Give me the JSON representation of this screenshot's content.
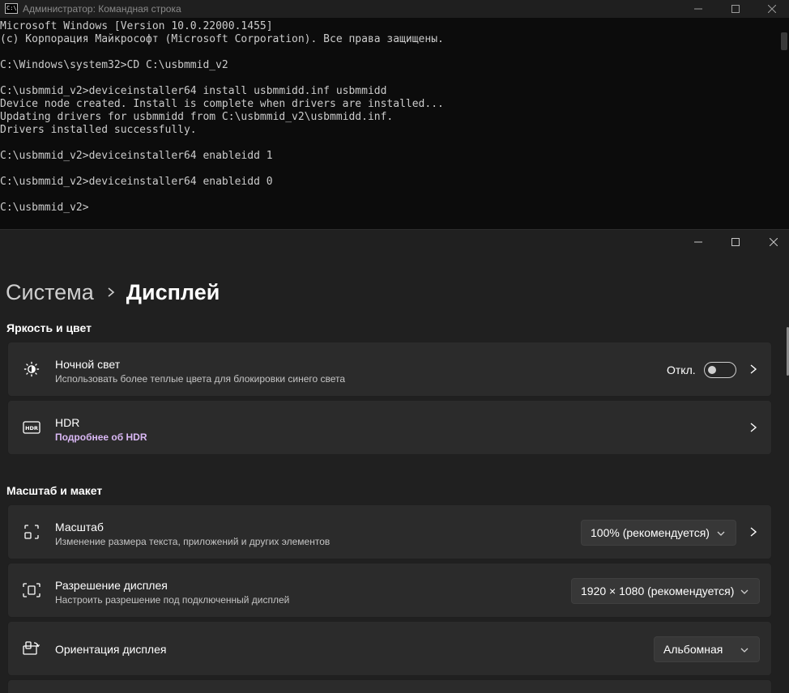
{
  "cmd": {
    "title": "Администратор: Командная строка",
    "lines": [
      "Microsoft Windows [Version 10.0.22000.1455]",
      "(c) Корпорация Майкрософт (Microsoft Corporation). Все права защищены.",
      "",
      "C:\\Windows\\system32>CD C:\\usbmmid_v2",
      "",
      "C:\\usbmmid_v2>deviceinstaller64 install usbmmidd.inf usbmmidd",
      "Device node created. Install is complete when drivers are installed...",
      "Updating drivers for usbmmidd from C:\\usbmmid_v2\\usbmmidd.inf.",
      "Drivers installed successfully.",
      "",
      "C:\\usbmmid_v2>deviceinstaller64 enableidd 1",
      "",
      "C:\\usbmmid_v2>deviceinstaller64 enableidd 0",
      "",
      "C:\\usbmmid_v2>"
    ]
  },
  "settings": {
    "breadcrumb": {
      "parent": "Система",
      "current": "Дисплей"
    },
    "sections": {
      "brightness": "Яркость и цвет",
      "scale_layout": "Масштаб и макет"
    },
    "night_light": {
      "title": "Ночной свет",
      "subtitle": "Использовать более теплые цвета для блокировки синего света",
      "toggle_label": "Откл.",
      "toggle_on": false
    },
    "hdr": {
      "title": "HDR",
      "link": "Подробнее об HDR"
    },
    "scale": {
      "title": "Масштаб",
      "subtitle": "Изменение размера текста, приложений и других элементов",
      "value": "100% (рекомендуется)"
    },
    "resolution": {
      "title": "Разрешение дисплея",
      "subtitle": "Настроить разрешение под подключенный дисплей",
      "value": "1920 × 1080 (рекомендуется)"
    },
    "orientation": {
      "title": "Ориентация дисплея",
      "value": "Альбомная"
    }
  },
  "colors": {
    "cmd_bg": "#0c0c0c",
    "settings_bg": "#202020",
    "card_bg": "#2b2b2b",
    "link": "#dab8f5"
  }
}
